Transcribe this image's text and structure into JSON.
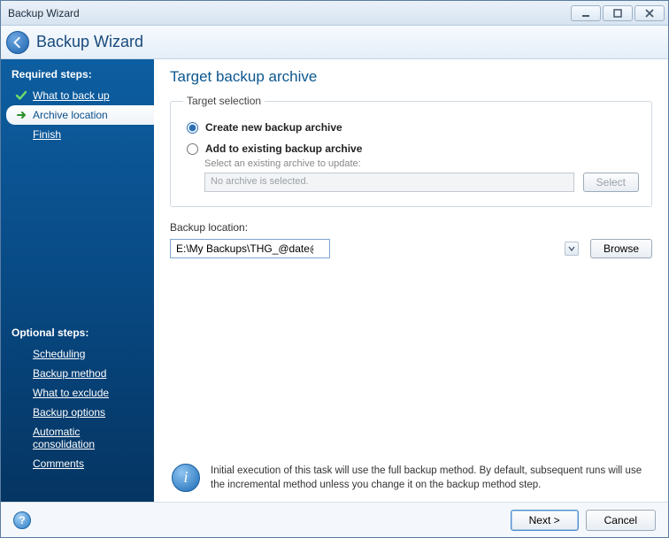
{
  "titlebar": {
    "title": "Backup Wizard"
  },
  "header": {
    "title": "Backup Wizard"
  },
  "sidebar": {
    "required_label": "Required steps:",
    "optional_label": "Optional steps:",
    "required": [
      {
        "label": "What to back up"
      },
      {
        "label": "Archive location"
      },
      {
        "label": "Finish"
      }
    ],
    "optional": [
      {
        "label": "Scheduling"
      },
      {
        "label": "Backup method"
      },
      {
        "label": "What to exclude"
      },
      {
        "label": "Backup options"
      },
      {
        "label": "Automatic consolidation"
      },
      {
        "label": "Comments"
      }
    ]
  },
  "main": {
    "title": "Target backup archive",
    "fieldset_legend": "Target selection",
    "radio_create": "Create new backup archive",
    "radio_add": "Add to existing backup archive",
    "existing_sub": "Select an existing archive to update:",
    "existing_placeholder": "No archive is selected.",
    "select_btn": "Select",
    "location_label": "Backup location:",
    "location_value": "E:\\My Backups\\THG_@date@.tib",
    "browse_btn": "Browse",
    "info_text": "Initial execution of this task will use the full backup method. By default, subsequent runs will use the incremental method unless you change it on the backup method step."
  },
  "footer": {
    "next": "Next >",
    "cancel": "Cancel"
  }
}
